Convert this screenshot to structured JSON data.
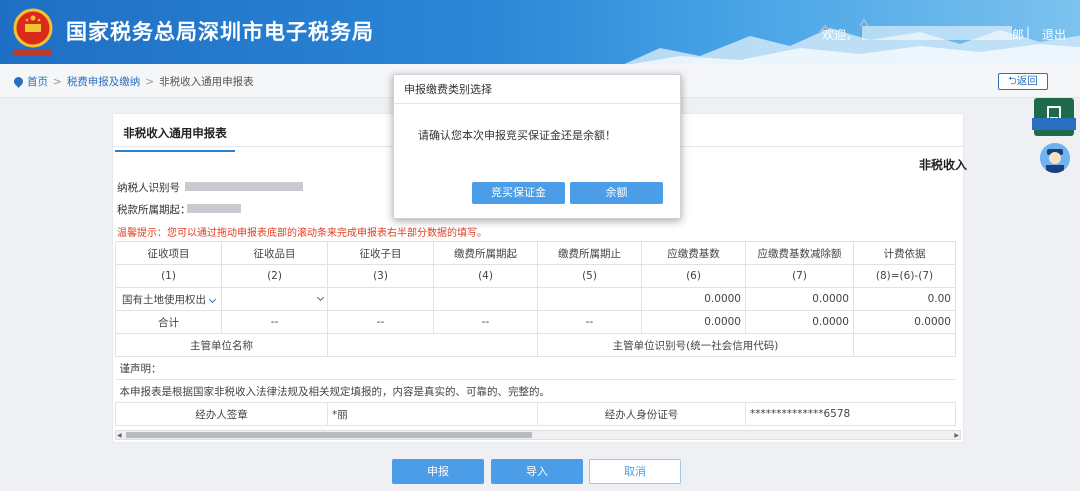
{
  "header": {
    "title": "国家税务总局深圳市电子税务局",
    "welcome": "欢迎，",
    "user_tail": "郎",
    "separator": "|",
    "logout": "退出"
  },
  "breadcrumb": {
    "home": "首页",
    "sep": ">",
    "level1": "税费申报及缴纳",
    "current": "非税收入通用申报表"
  },
  "back_label": "返回",
  "tab_label": "非税收入通用申报表",
  "form_title": "非税收入",
  "fields": {
    "taxpayer_id_label": "纳税人识别号",
    "period_label": "税款所属期起："
  },
  "tip": "温馨提示：您可以通过拖动申报表底部的滚动条来完成申报表右半部分数据的填写。",
  "table": {
    "headers": [
      "征收项目",
      "征收品目",
      "征收子目",
      "缴费所属期起",
      "缴费所属期止",
      "应缴费基数",
      "应缴费基数减除额",
      "计费依据"
    ],
    "codes": [
      "(1)",
      "(2)",
      "(3)",
      "(4)",
      "(5)",
      "(6)",
      "(7)",
      "(8)=(6)-(7)"
    ],
    "row1": {
      "item": "国有土地使用权出让",
      "base": "0.0000",
      "deduct": "0.0000",
      "basis": "0.00"
    },
    "total": {
      "label": "合计",
      "dash": "--",
      "base": "0.0000",
      "deduct": "0.0000",
      "basis": "0.0000"
    },
    "org_name_label": "主管单位名称",
    "org_id_label": "主管单位识别号(统一社会信用代码)",
    "declare_label": "谨声明：",
    "declare_text": "本申报表是根据国家非税收入法律法规及相关规定填报的，内容是真实的、可靠的、完整的。",
    "agent_sign_label": "经办人签章",
    "agent_sign_value": "*丽",
    "agent_id_label": "经办人身份证号",
    "agent_id_value": "**************6578"
  },
  "buttons": {
    "submit": "申报",
    "import": "导入",
    "cancel": "取消"
  },
  "modal": {
    "title": "申报缴费类别选择",
    "message": "请确认您本次申报竞买保证金还是余额！",
    "deposit": "竞买保证金",
    "balance": "余额"
  },
  "colors": {
    "accent": "#4a9de6",
    "link": "#2a6fbf",
    "warning": "#e03c1f"
  }
}
